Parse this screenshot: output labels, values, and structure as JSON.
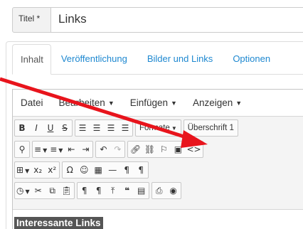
{
  "title_field": {
    "label": "Titel *",
    "value": "Links"
  },
  "tabs": [
    {
      "label": "Inhalt"
    },
    {
      "label": "Veröffentlichung"
    },
    {
      "label": "Bilder und Links"
    },
    {
      "label": "Optionen"
    }
  ],
  "menubar": [
    {
      "label": "Datei"
    },
    {
      "label": "Bearbeiten"
    },
    {
      "label": "Einfügen"
    },
    {
      "label": "Anzeigen"
    }
  ],
  "toolbar": {
    "formats_label": "Formate",
    "headings_label": "Überschrift 1"
  },
  "content": {
    "selected_text": "Interessante Links"
  },
  "colors": {
    "accent": "#1e88d0",
    "arrow": "#e8141c",
    "selection": "#555555"
  }
}
